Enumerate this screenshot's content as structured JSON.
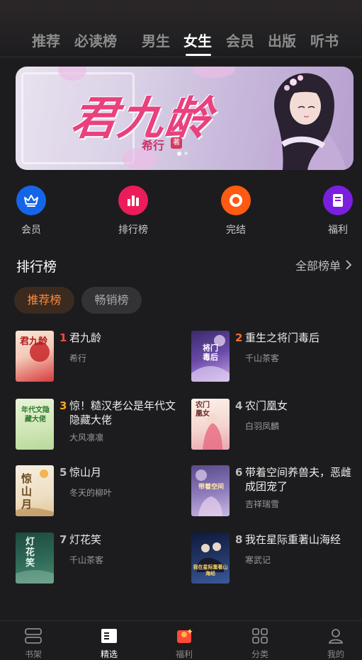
{
  "top_tabs": [
    "推荐",
    "必读榜",
    "男生",
    "女生",
    "会员",
    "出版",
    "听书"
  ],
  "active_tab_index": 3,
  "banner": {
    "title": "君九龄",
    "author": "希行",
    "seal": "著",
    "slide_count": 2,
    "active_slide": 0
  },
  "quick_links": [
    {
      "label": "会员",
      "color": "#1565e8",
      "icon": "crown-icon"
    },
    {
      "label": "排行榜",
      "color": "#ec1c5a",
      "icon": "bar-chart-icon"
    },
    {
      "label": "完结",
      "color": "#ff5a12",
      "icon": "ring-icon"
    },
    {
      "label": "福利",
      "color": "#7a1fe0",
      "icon": "gift-card-icon"
    }
  ],
  "ranking": {
    "title": "排行榜",
    "more_label": "全部榜单",
    "chips": [
      "推荐榜",
      "畅销榜"
    ],
    "active_chip": 0,
    "books": [
      {
        "rank": "1",
        "title": "君九龄",
        "author": "希行",
        "cover_text": "君九龄"
      },
      {
        "rank": "2",
        "title": "重生之将门毒后",
        "author": "千山茶客",
        "cover_text": "将门毒后"
      },
      {
        "rank": "3",
        "title": "惊！糙汉老公是年代文隐藏大佬",
        "author": "大风凛凛",
        "cover_text": "年代文隐藏大佬"
      },
      {
        "rank": "4",
        "title": "农门凰女",
        "author": "白羽凤麟",
        "cover_text": "农门凰女"
      },
      {
        "rank": "5",
        "title": "惊山月",
        "author": "冬天的柳叶",
        "cover_text": "惊山月"
      },
      {
        "rank": "6",
        "title": "带着空间养兽夫，恶雌成团宠了",
        "author": "吉祥瑞雪",
        "cover_text": "带着空间"
      },
      {
        "rank": "7",
        "title": "灯花笑",
        "author": "千山茶客",
        "cover_text": "灯花笑"
      },
      {
        "rank": "8",
        "title": "我在星际重著山海经",
        "author": "寒武记",
        "cover_text": "我在星际重著山海经"
      }
    ]
  },
  "bottom_nav": [
    "书架",
    "精选",
    "福利",
    "分类",
    "我的"
  ],
  "active_nav_index": 1,
  "colors": {
    "accent": "#ff8a3a",
    "rank_top": "#ff4a3a",
    "rank_mid": "#f5a623",
    "rank_other": "#bdbdbd"
  }
}
